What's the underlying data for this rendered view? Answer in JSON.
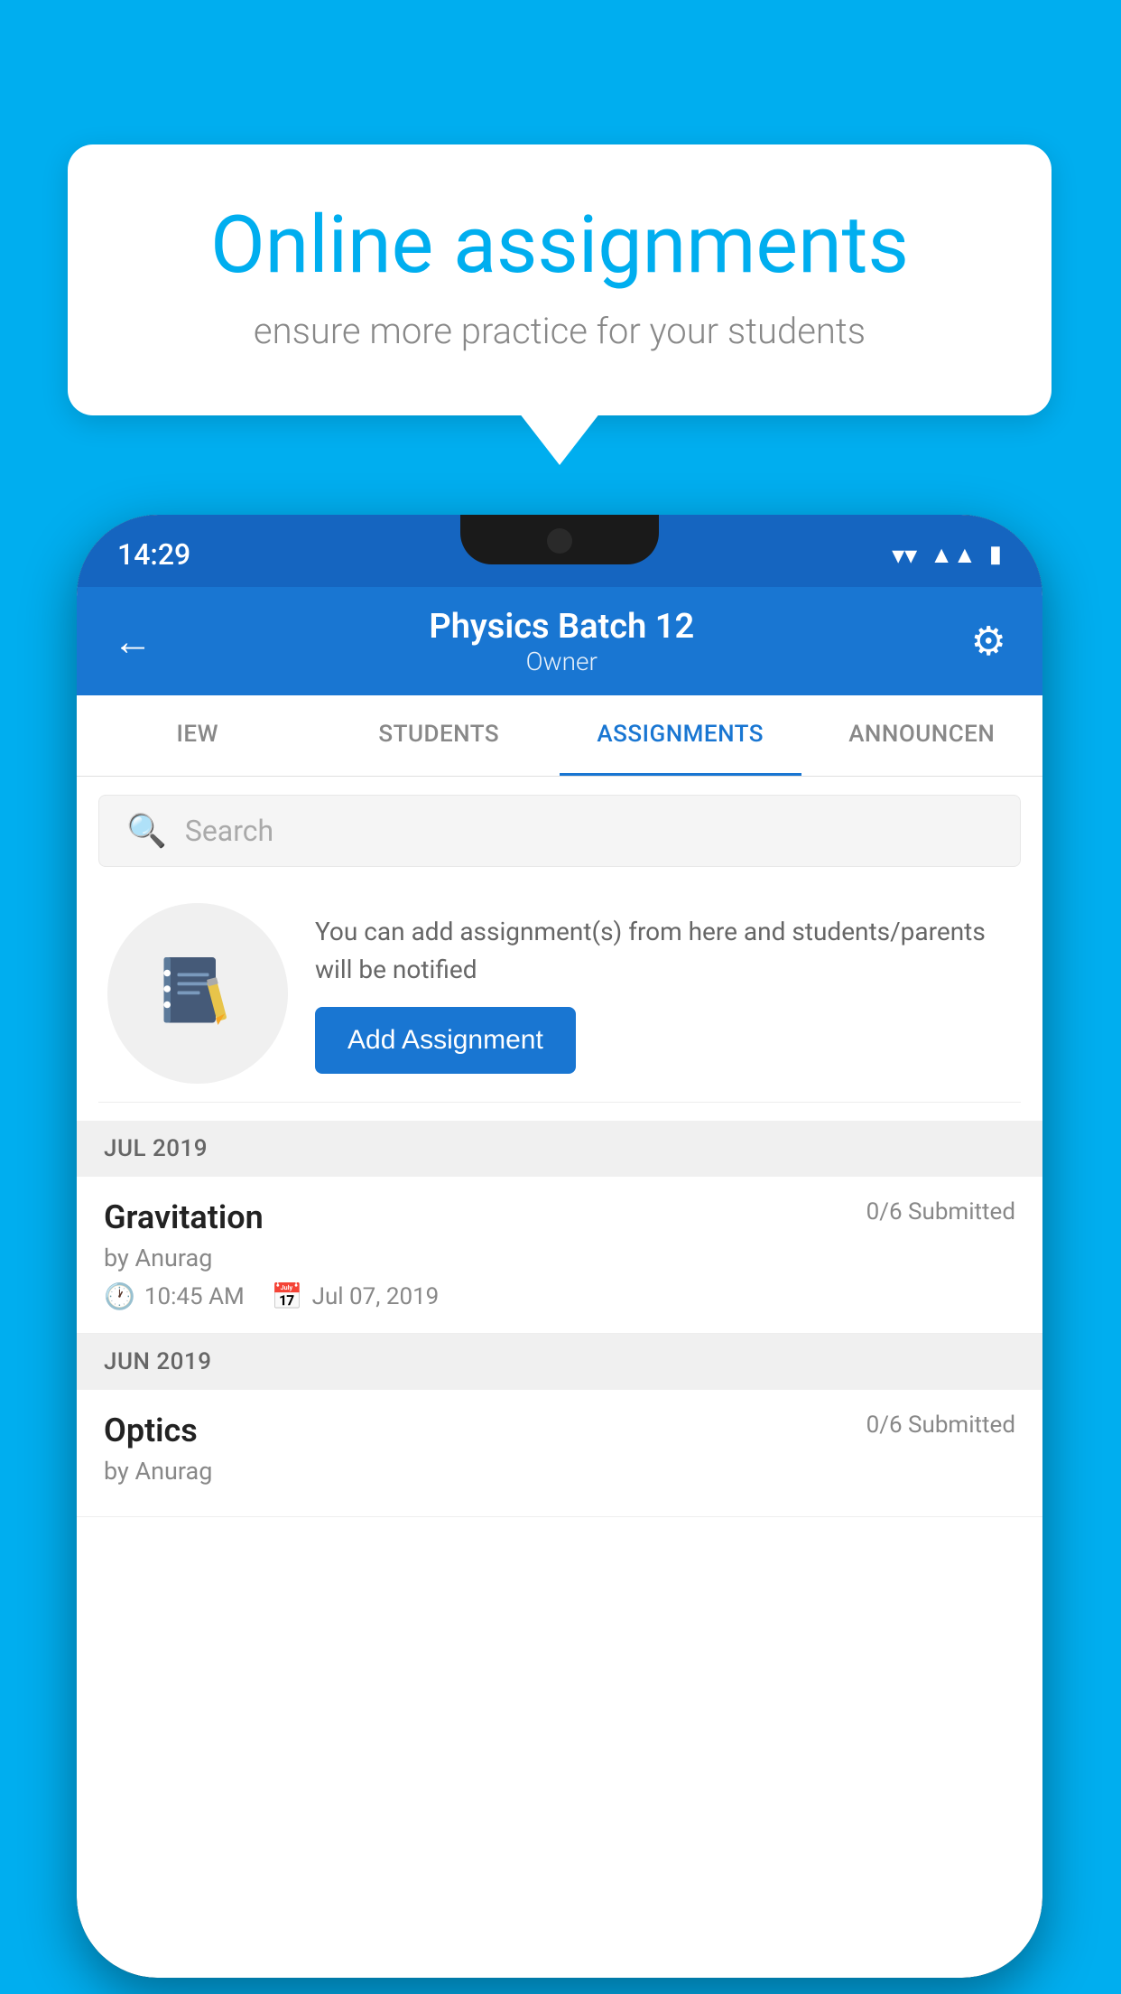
{
  "background_color": "#00AEEF",
  "speech_bubble": {
    "title": "Online assignments",
    "subtitle": "ensure more practice for your students"
  },
  "status_bar": {
    "time": "14:29",
    "wifi_icon": "▼",
    "signal_icon": "◀",
    "battery_icon": "▮"
  },
  "app_bar": {
    "back_icon": "←",
    "title": "Physics Batch 12",
    "subtitle": "Owner",
    "settings_icon": "⚙"
  },
  "tabs": [
    {
      "label": "IEW",
      "active": false
    },
    {
      "label": "STUDENTS",
      "active": false
    },
    {
      "label": "ASSIGNMENTS",
      "active": true
    },
    {
      "label": "ANNOUNCEN",
      "active": false
    }
  ],
  "search": {
    "placeholder": "Search"
  },
  "add_assignment_section": {
    "promo_text": "You can add assignment(s) from here and students/parents will be notified",
    "button_label": "Add Assignment"
  },
  "sections": [
    {
      "header": "JUL 2019",
      "assignments": [
        {
          "name": "Gravitation",
          "submitted": "0/6 Submitted",
          "author": "by Anurag",
          "time": "10:45 AM",
          "date": "Jul 07, 2019"
        }
      ]
    },
    {
      "header": "JUN 2019",
      "assignments": [
        {
          "name": "Optics",
          "submitted": "0/6 Submitted",
          "author": "by Anurag",
          "time": "",
          "date": ""
        }
      ]
    }
  ]
}
